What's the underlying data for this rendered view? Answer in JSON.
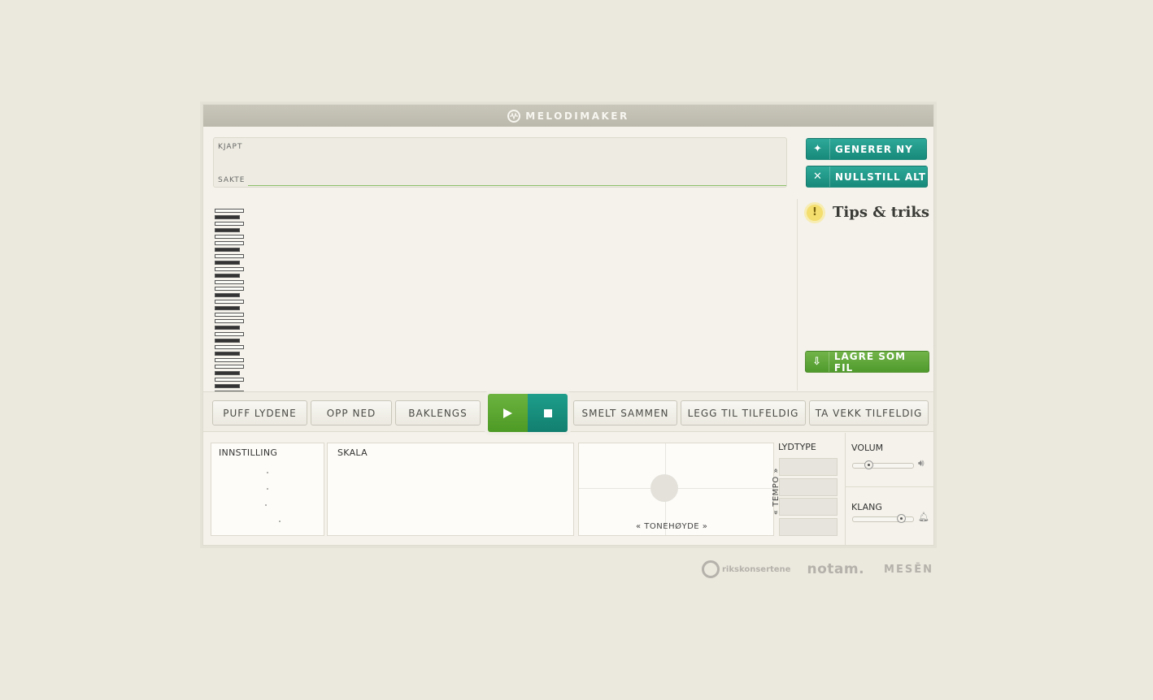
{
  "app": {
    "title": "MELODIMAKER"
  },
  "speed": {
    "fast_label": "KJAPT",
    "slow_label": "SAKTE"
  },
  "side": {
    "generate": "GENERER NY",
    "reset": "NULLSTILL ALT",
    "tips": "Tips & triks",
    "save": "LAGRE SOM FIL"
  },
  "toolbar": {
    "puff": "PUFF LYDENE",
    "flip": "OPP NED",
    "reverse": "BAKLENGS",
    "merge": "SMELT SAMMEN",
    "add_random": "LEGG TIL TILFELDIG",
    "remove_random": "TA VEKK TILFELDIG"
  },
  "panels": {
    "setting": "INNSTILLING",
    "scale": "SKALA",
    "pitch": "« TONEHØYDE »",
    "tempo": "« TEMPO »",
    "soundtype": "LYDTYPE",
    "volume": "VOLUM",
    "timbre": "KLANG",
    "volume_level": 0.25,
    "timbre_level": 0.8
  },
  "footer": {
    "rk": "rikskonsertene",
    "notam": "notam.",
    "mesen": "MESĒN"
  }
}
